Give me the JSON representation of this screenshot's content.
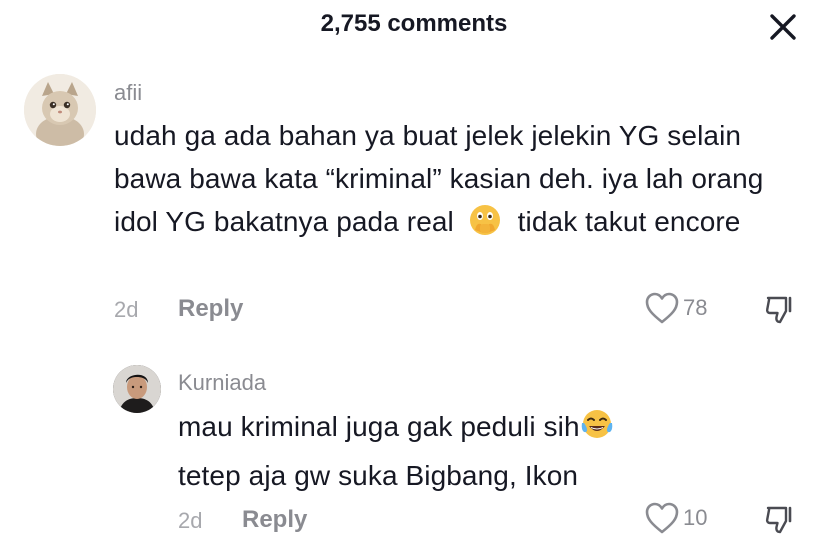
{
  "header": {
    "title": "2,755 comments",
    "close_icon": "close-icon"
  },
  "comments": [
    {
      "username": "afii",
      "avatar": "cat-avatar",
      "text_before_emoji": "udah ga ada bahan ya buat jelek jelekin YG selain bawa bawa kata “kriminal” kasian deh. iya lah orang idol YG bakatnya pada real",
      "emoji": "face-with-open-eyes-and-hand-over-mouth",
      "text_after_emoji": "tidak takut encore",
      "time": "2d",
      "reply_label": "Reply",
      "likes": "78"
    },
    {
      "username": "Kurniada",
      "avatar": "person-avatar",
      "text_before_emoji": "mau kriminal juga gak peduli sih",
      "emoji": "tears-of-joy",
      "text_after_emoji": "tetep aja gw suka Bigbang, Ikon",
      "time": "2d",
      "reply_label": "Reply",
      "likes": "10"
    }
  ],
  "colors": {
    "text": "#161823",
    "muted": "#8a8b91",
    "time": "#a7a8ad",
    "background": "#ffffff"
  }
}
